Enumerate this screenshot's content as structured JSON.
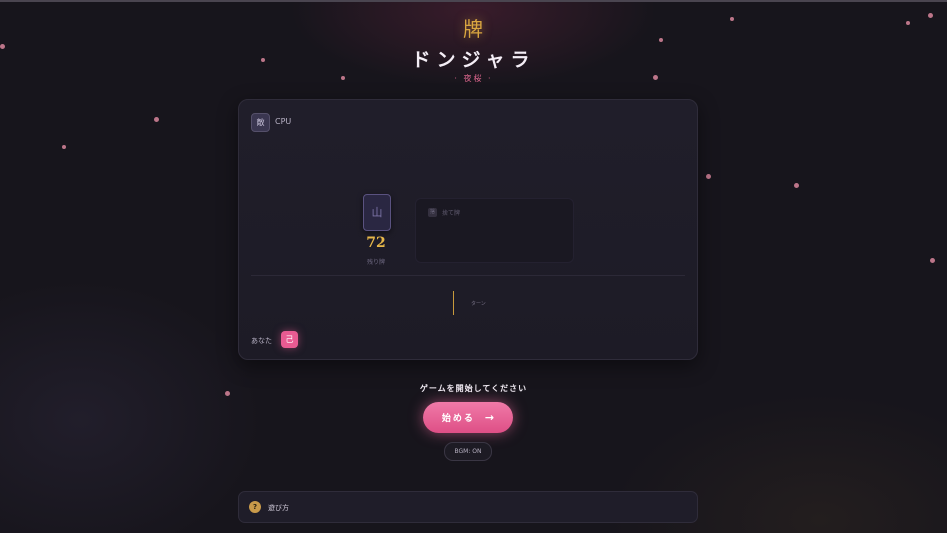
{
  "app": {
    "emblem": "牌",
    "title": "ドンジャラ",
    "subtitle": "· 夜桜 ·"
  },
  "board": {
    "cpu": {
      "avatar": "敵",
      "name": "CPU"
    },
    "deck": {
      "glyph": "山",
      "count": "72",
      "label": "残り牌"
    },
    "discard": {
      "icon": "捨",
      "label": "捨て牌"
    },
    "turn": {
      "text": "ターン"
    },
    "player": {
      "name": "あなた",
      "avatar": "己"
    }
  },
  "controls": {
    "prompt": "ゲームを開始してください",
    "start_label": "始める",
    "start_icon": "→",
    "bgm_label": "BGM: ON"
  },
  "howto": {
    "icon": "?",
    "label": "遊び方"
  },
  "colors": {
    "accent_pink": "#e85b92",
    "accent_gold": "#d9a640",
    "background": "#17151c"
  }
}
